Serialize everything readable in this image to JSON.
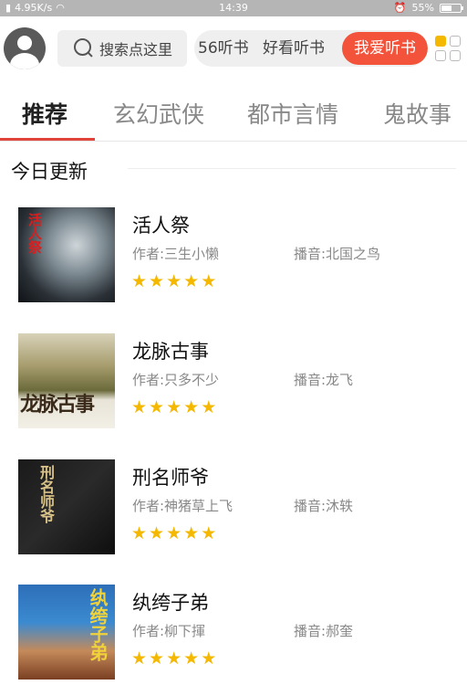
{
  "status_bar": {
    "net_speed": "4.95K/s",
    "time": "14:39",
    "battery": "55%",
    "battery_level": 0.55
  },
  "header": {
    "search_placeholder": "搜索点这里",
    "chips": [
      "56听书",
      "好看听书",
      "我爱听书"
    ],
    "active_chip_index": 2
  },
  "tabs": [
    "推荐",
    "玄幻武侠",
    "都市言情",
    "鬼故事"
  ],
  "active_tab_index": 0,
  "section_title": "今日更新",
  "books": [
    {
      "title": "活人祭",
      "author": "作者:三生小懒",
      "narrator": "播音:北国之鸟",
      "rating": 5,
      "cover_text": "活人祭"
    },
    {
      "title": "龙脉古事",
      "author": "作者:只多不少",
      "narrator": "播音:龙飞",
      "rating": 5,
      "cover_text": "龙脉古事"
    },
    {
      "title": "刑名师爷",
      "author": "作者:神猪草上飞",
      "narrator": "播音:沐轶",
      "rating": 5,
      "cover_text": "刑名师爷"
    },
    {
      "title": "纨绔子弟",
      "author": "作者:柳下揮",
      "narrator": "播音:郝奎",
      "rating": 5,
      "cover_text": "纨绔子弟"
    }
  ],
  "colors": {
    "accent": "#f2533a",
    "tab_underline": "#e0433a",
    "star": "#f5b800"
  }
}
